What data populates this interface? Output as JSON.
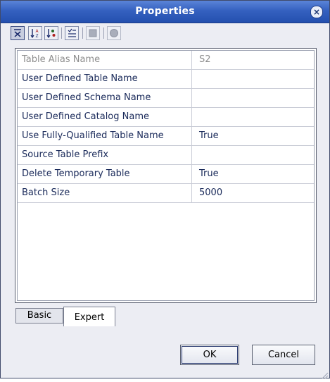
{
  "window": {
    "title": "Properties"
  },
  "toolbar": {
    "buttons": [
      {
        "name": "categorized-view-icon",
        "state": "pressed"
      },
      {
        "name": "sort-alphabetical-icon",
        "state": "normal"
      },
      {
        "name": "sort-by-type-icon",
        "state": "normal"
      },
      {
        "name": "show-descriptions-icon",
        "state": "normal"
      },
      {
        "name": "property-editor-icon",
        "state": "disabled"
      },
      {
        "name": "help-icon",
        "state": "disabled"
      }
    ]
  },
  "properties": [
    {
      "name": "Table Alias Name",
      "value": "S2",
      "disabled": true
    },
    {
      "name": "User Defined Table Name",
      "value": ""
    },
    {
      "name": "User Defined Schema Name",
      "value": ""
    },
    {
      "name": "User Defined Catalog Name",
      "value": ""
    },
    {
      "name": "Use Fully-Qualified Table Name",
      "value": "True"
    },
    {
      "name": "Source Table Prefix",
      "value": ""
    },
    {
      "name": "Delete Temporary Table",
      "value": "True"
    },
    {
      "name": "Batch Size",
      "value": "5000"
    }
  ],
  "tabs": {
    "basic": "Basic",
    "expert": "Expert",
    "selected": "Expert"
  },
  "buttons": {
    "ok": "OK",
    "cancel": "Cancel"
  },
  "colors": {
    "titlebar": "#3561c0",
    "text": "#1a2a5a",
    "disabled_text": "#8e8e8e"
  }
}
